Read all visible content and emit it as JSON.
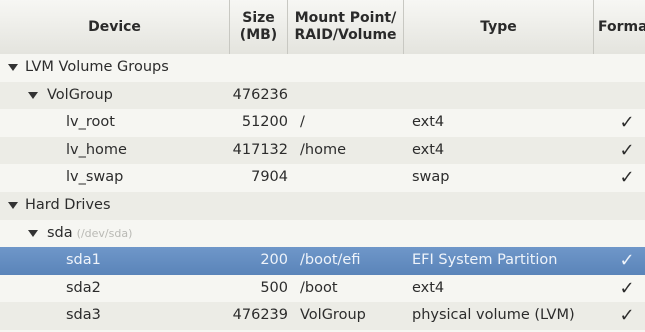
{
  "columns": {
    "device": "Device",
    "size": "Size\n(MB)",
    "mount": "Mount Point/\nRAID/Volume",
    "type": "Type",
    "format": "Format"
  },
  "rows": [
    {
      "name": "LVM Volume Groups",
      "sub": "",
      "size": "",
      "mount": "",
      "type": "",
      "format": "",
      "level": 0,
      "expander": true,
      "selected": false
    },
    {
      "name": "VolGroup",
      "sub": "",
      "size": "476236",
      "mount": "",
      "type": "",
      "format": "",
      "level": 1,
      "expander": true,
      "selected": false
    },
    {
      "name": "lv_root",
      "sub": "",
      "size": "51200",
      "mount": "/",
      "type": "ext4",
      "format": "✓",
      "level": 2,
      "expander": false,
      "selected": false
    },
    {
      "name": "lv_home",
      "sub": "",
      "size": "417132",
      "mount": "/home",
      "type": "ext4",
      "format": "✓",
      "level": 2,
      "expander": false,
      "selected": false
    },
    {
      "name": "lv_swap",
      "sub": "",
      "size": "7904",
      "mount": "",
      "type": "swap",
      "format": "✓",
      "level": 2,
      "expander": false,
      "selected": false
    },
    {
      "name": "Hard Drives",
      "sub": "",
      "size": "",
      "mount": "",
      "type": "",
      "format": "",
      "level": 0,
      "expander": true,
      "selected": false
    },
    {
      "name": "sda",
      "sub": "(/dev/sda)",
      "size": "",
      "mount": "",
      "type": "",
      "format": "",
      "level": 1,
      "expander": true,
      "selected": false
    },
    {
      "name": "sda1",
      "sub": "",
      "size": "200",
      "mount": "/boot/efi",
      "type": "EFI System Partition",
      "format": "✓",
      "level": 2,
      "expander": false,
      "selected": true
    },
    {
      "name": "sda2",
      "sub": "",
      "size": "500",
      "mount": "/boot",
      "type": "ext4",
      "format": "✓",
      "level": 2,
      "expander": false,
      "selected": false
    },
    {
      "name": "sda3",
      "sub": "",
      "size": "476239",
      "mount": "VolGroup",
      "type": "physical volume (LVM)",
      "format": "✓",
      "level": 2,
      "expander": false,
      "selected": false
    }
  ]
}
